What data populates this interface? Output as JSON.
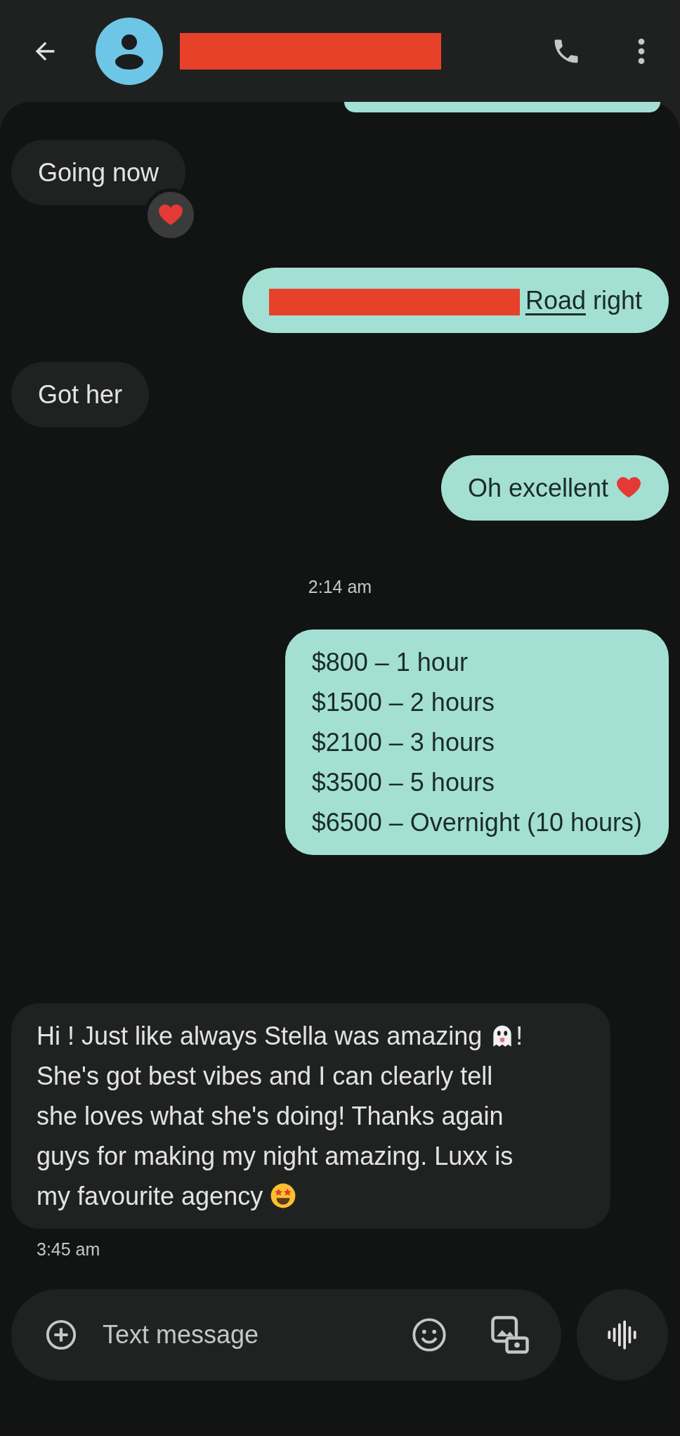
{
  "header": {
    "contact": {
      "redacted": true
    }
  },
  "messages": [
    {
      "kind": "incoming",
      "segments": [
        {
          "kind": "text",
          "text": "Going now"
        }
      ],
      "reacted": true
    },
    {
      "kind": "outgoing",
      "segments": [
        {
          "kind": "redaction"
        },
        {
          "kind": "link",
          "text": "Road"
        },
        {
          "kind": "text",
          "text": " right"
        }
      ]
    },
    {
      "kind": "incoming",
      "segments": [
        {
          "kind": "text",
          "text": "Got her"
        }
      ]
    },
    {
      "kind": "outgoing",
      "segments": [
        {
          "kind": "text",
          "text": "Oh excellent "
        },
        {
          "kind": "heart-emoji"
        }
      ]
    },
    {
      "kind": "timestamp",
      "text": "2:14 am"
    },
    {
      "kind": "outgoing",
      "lines": [
        "$800 – 1 hour",
        "$1500 – 2 hours",
        "$2100 – 3 hours",
        "$3500 – 5 hours",
        "$6500 – Overnight (10 hours)"
      ]
    },
    {
      "kind": "incoming",
      "segments": [
        {
          "kind": "text",
          "text": "Hi ! Just like always Stella was amazing "
        },
        {
          "kind": "ghost-emoji"
        },
        {
          "kind": "text",
          "text": "! She's got best vibes and I can clearly tell she loves what she's doing! Thanks again guys for making my night amazing. Luxx is my favourite agency "
        },
        {
          "kind": "star-struck-emoji"
        }
      ]
    },
    {
      "kind": "timestamp",
      "text": "3:45 am"
    }
  ],
  "composer": {
    "placeholder": "Text message"
  }
}
